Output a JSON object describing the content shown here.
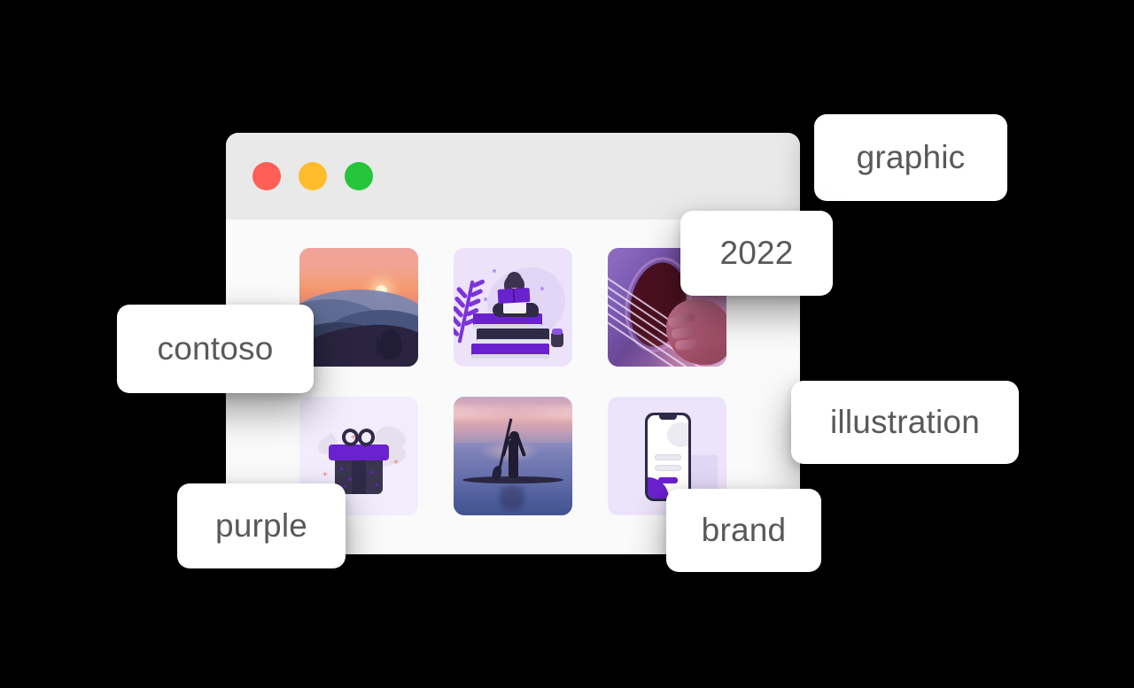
{
  "window": {
    "title_bar": {
      "controls": [
        {
          "name": "close",
          "color": "#ff5f56",
          "label": ""
        },
        {
          "name": "minimize",
          "color": "#ffbd2e",
          "label": ""
        },
        {
          "name": "maximize",
          "color": "#25c63b",
          "label": ""
        }
      ]
    },
    "gallery": {
      "items": [
        {
          "id": "item-1",
          "alt": "Mountain sunset landscape photo",
          "kind": "photo"
        },
        {
          "id": "item-2",
          "alt": "Illustration of a person reading on a stack of books",
          "kind": "illustration"
        },
        {
          "id": "item-3",
          "alt": "Close-up photo of hands playing an acoustic guitar",
          "kind": "photo"
        },
        {
          "id": "item-4",
          "alt": "Illustration of a purple gift box with a bow",
          "kind": "illustration"
        },
        {
          "id": "item-5",
          "alt": "Silhouette of a paddleboarder at sunset",
          "kind": "photo"
        },
        {
          "id": "item-6",
          "alt": "Illustration of a smartphone app mockup",
          "kind": "illustration"
        }
      ]
    }
  },
  "tags": [
    {
      "id": "tag-contoso",
      "label": "contoso"
    },
    {
      "id": "tag-purple",
      "label": "purple"
    },
    {
      "id": "tag-graphic",
      "label": "graphic"
    },
    {
      "id": "tag-2022",
      "label": "2022"
    },
    {
      "id": "tag-illustration",
      "label": "illustration"
    },
    {
      "id": "tag-brand",
      "label": "brand"
    }
  ],
  "colors": {
    "background": "#000000",
    "window_body": "#fafafb",
    "title_bar": "#e9e9e9",
    "tag_background": "#ffffff",
    "tag_text": "#595959",
    "accent_purple": "#6a21cf",
    "tile_lavender": "#ece4fa"
  }
}
